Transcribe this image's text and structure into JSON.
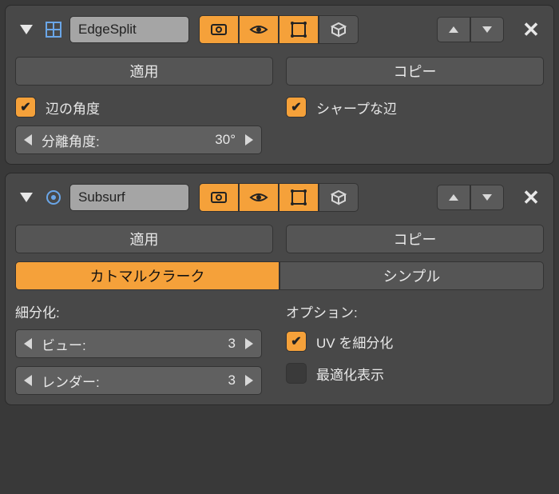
{
  "modifier1": {
    "name": "EdgeSplit",
    "apply": "適用",
    "copy": "コピー",
    "edge_angle_label": "辺の角度",
    "sharp_edge_label": "シャープな辺",
    "split_angle_label": "分離角度:",
    "split_angle_value": "30°"
  },
  "modifier2": {
    "name": "Subsurf",
    "apply": "適用",
    "copy": "コピー",
    "tab_catmull": "カトマルクラーク",
    "tab_simple": "シンプル",
    "subdivision_label": "細分化:",
    "options_label": "オプション:",
    "view_label": "ビュー:",
    "view_value": "3",
    "render_label": "レンダー:",
    "render_value": "3",
    "uv_subdivide": "UV を細分化",
    "optimal_display": "最適化表示"
  }
}
